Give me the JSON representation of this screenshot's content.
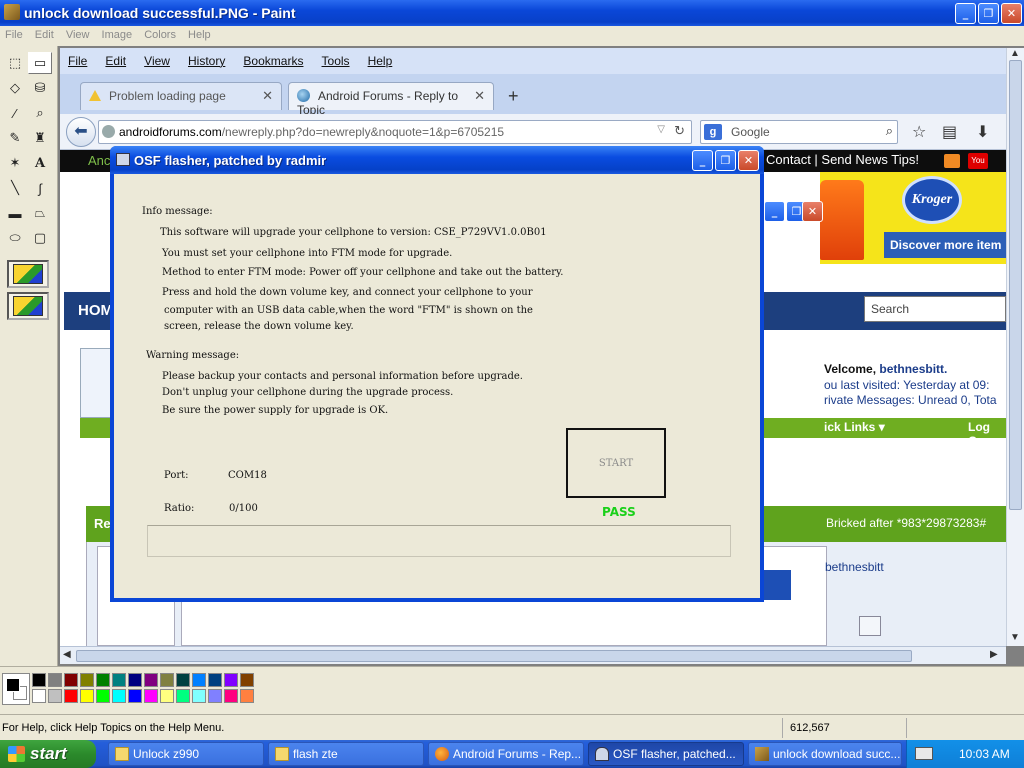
{
  "paint": {
    "title": "unlock download successful.PNG - Paint",
    "menu": [
      "File",
      "Edit",
      "View",
      "Image",
      "Colors",
      "Help"
    ],
    "status_help": "For Help, click Help Topics on the Help Menu.",
    "status_coords": "612,567",
    "palette": [
      "#000000",
      "#808080",
      "#800000",
      "#808000",
      "#008000",
      "#008080",
      "#000080",
      "#800080",
      "#808040",
      "#004040",
      "#0080ff",
      "#004080",
      "#8000ff",
      "#804000",
      "#ffffff",
      "#c0c0c0",
      "#ff0000",
      "#ffff00",
      "#00ff00",
      "#00ffff",
      "#0000ff",
      "#ff00ff",
      "#ffff80",
      "#00ff80",
      "#80ffff",
      "#8080ff",
      "#ff0080",
      "#ff8040"
    ]
  },
  "firefox": {
    "menu": [
      "File",
      "Edit",
      "View",
      "History",
      "Bookmarks",
      "Tools",
      "Help"
    ],
    "tabs": [
      {
        "label": "Problem loading page"
      },
      {
        "label": "Android Forums - Reply to Topic"
      }
    ],
    "url_host": "androidforums.com",
    "url_path": "/newreply.php?do=newreply&noquote=1&p=6705215",
    "search_placeholder": "Google",
    "search_engine_letter": "g"
  },
  "webpage": {
    "topbar_fragment": "Anc",
    "topbar_links": "Contact | Send News Tips!",
    "youtube_label": "You Tube",
    "banner_logo": "Kroger",
    "banner_text": "Discover more item",
    "nav_home": "HOM",
    "search_placeholder": "Search",
    "welcome_prefix": "Velcome, ",
    "welcome_user": "bethnesbitt.",
    "last_visited": "ou last visited: Yesterday at 09:",
    "private_messages": "rivate Messages: Unread 0, Tota",
    "quick_links": "ick Links ▾",
    "log_out": "Log Ou",
    "reply_prefix": "Re",
    "thread_title": "Bricked after *983*29873283#",
    "username": "bethnesbitt"
  },
  "osf": {
    "title": "OSF flasher, patched by radmir",
    "info_heading": "Info message:",
    "info_lines": [
      "This software will upgrade your cellphone to version:   CSE_P729VV1.0.0B01",
      "You must set your cellphone into FTM mode for upgrade.",
      "Method to enter FTM mode: Power off your cellphone and take out the battery.",
      "Press and hold the down volume key, and connect your cellphone to your",
      "computer with an USB data cable,when the word \"FTM\" is shown on the",
      "screen, release the down volume key."
    ],
    "warning_heading": "Warning message:",
    "warning_lines": [
      "Please backup your contacts and personal information before upgrade.",
      "Don't unplug your cellphone during the upgrade process.",
      "Be sure the power supply for upgrade is OK."
    ],
    "port_label": "Port:",
    "port_value": "COM18",
    "ratio_label": "Ratio:",
    "ratio_value": "0/100",
    "start_label": "START",
    "result": "PASS",
    "progress_fraction": 0
  },
  "taskbar": {
    "start_label": "start",
    "tasks": [
      {
        "label": "Unlock z990",
        "icon": "folder-icon"
      },
      {
        "label": "flash zte",
        "icon": "folder-icon"
      },
      {
        "label": "Android Forums - Rep...",
        "icon": "firefox-icon"
      },
      {
        "label": "OSF flasher, patched...",
        "icon": "osf-icon"
      },
      {
        "label": "unlock download succ...",
        "icon": "paint-icon"
      }
    ],
    "clock": "10:03 AM"
  }
}
